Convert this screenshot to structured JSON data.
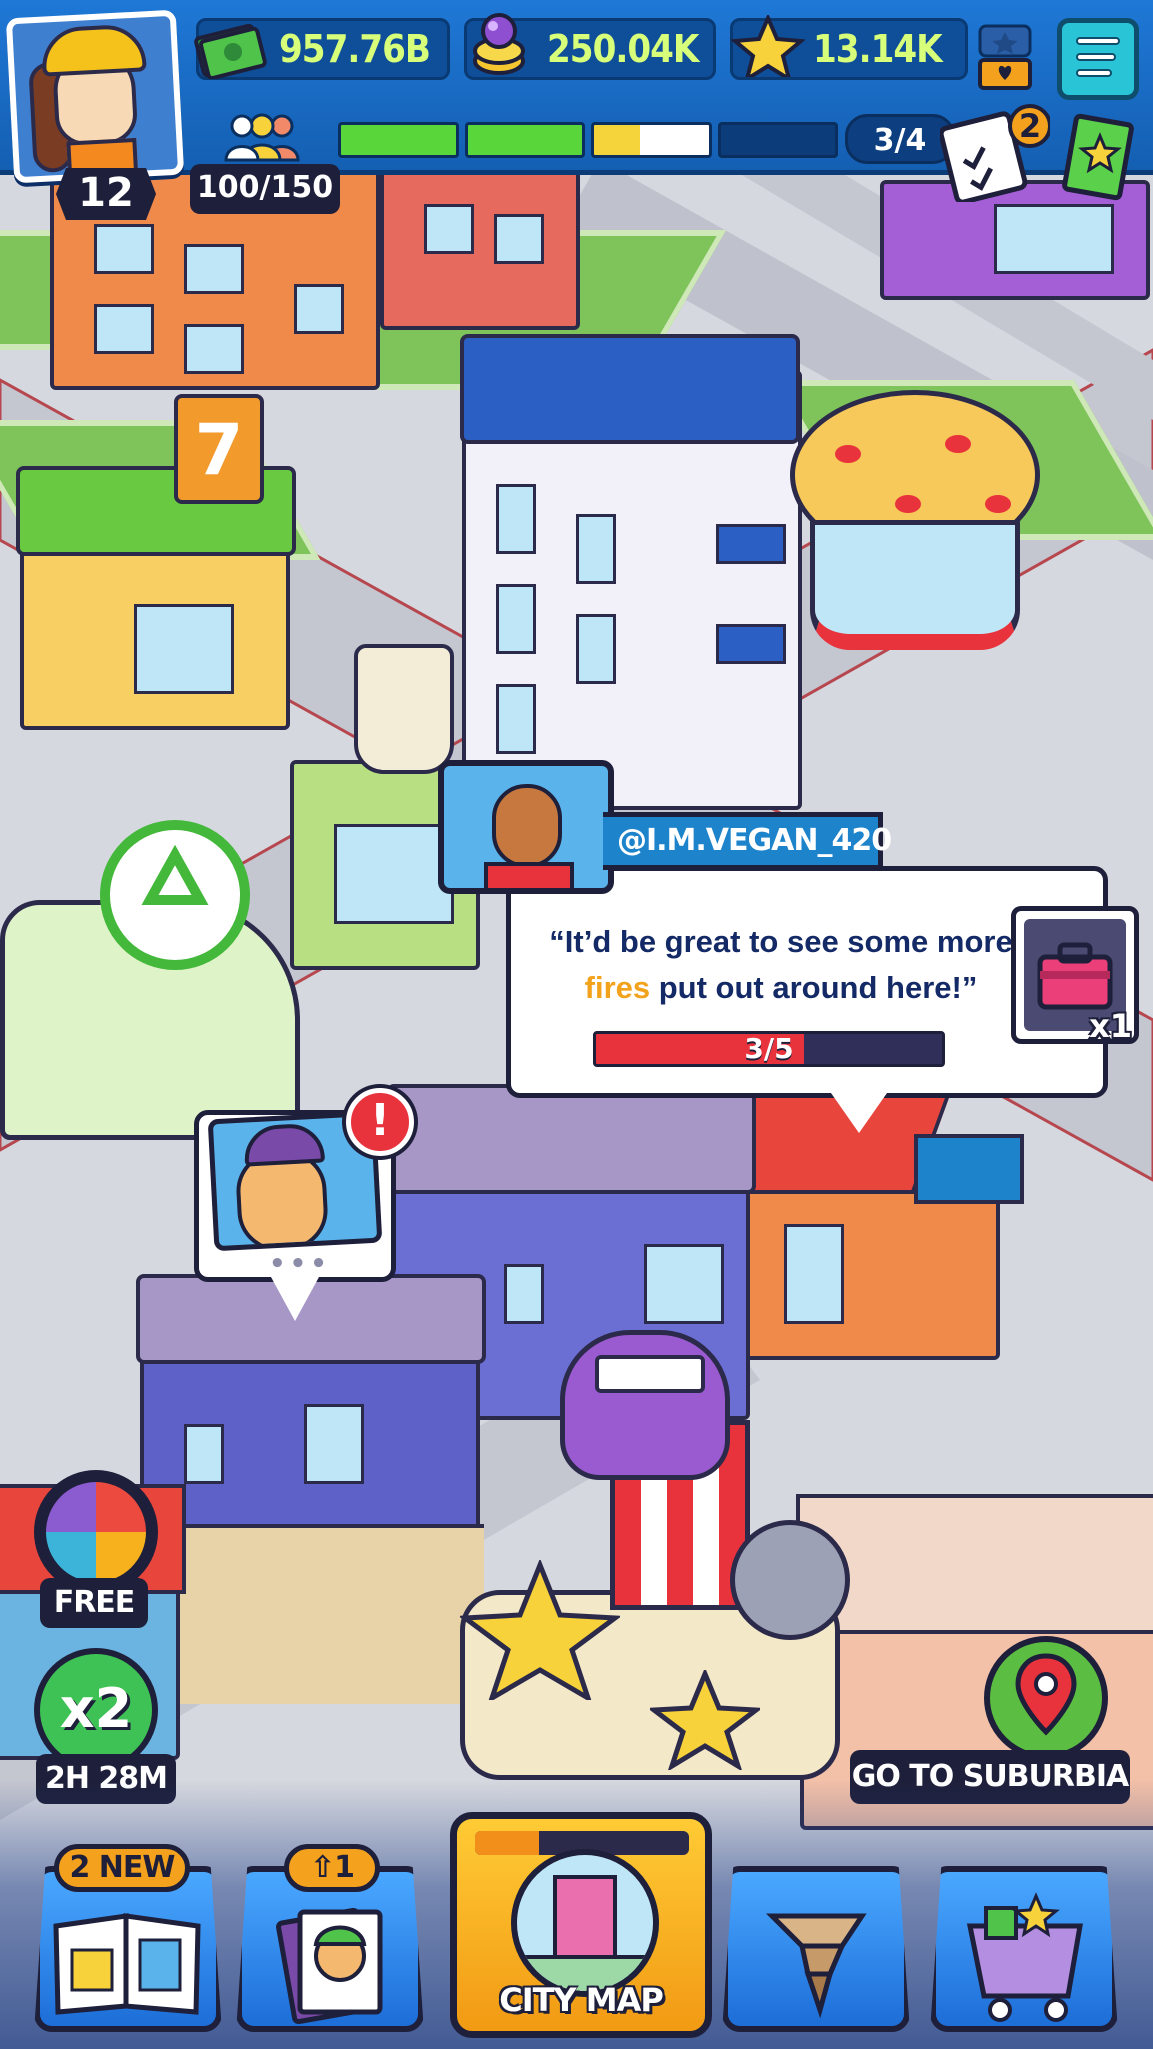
{
  "hud": {
    "player_level": "12",
    "population": "100/150",
    "cash": "957.76B",
    "gems": "250.04K",
    "stars": "13.14K",
    "quest_progress": "3/4",
    "quest_badge": "2",
    "level_progress_segments": [
      1,
      1,
      0.4,
      0
    ],
    "icons": {
      "cash": "cash-stack-icon",
      "gems": "gem-token-icon",
      "stars": "star-icon",
      "population": "population-icon",
      "menu": "menu-icon",
      "chest": "star-chest-icon",
      "quests": "clipboard-icon",
      "ticket": "ticket-icon"
    }
  },
  "quest": {
    "npc_handle": "@I.M.VEGAN_420",
    "text_before": "“It’d be great to see some more",
    "text_highlight": "fires",
    "text_after": "put out around here!”",
    "progress_label": "3/5",
    "progress_value": 0.6,
    "reward_qty": "x1",
    "reward_icon": "toolbox-icon"
  },
  "npc_bubble": {
    "alert": "!",
    "dots": "•••"
  },
  "left_buttons": {
    "wheel_label": "FREE",
    "boost_label": "x2",
    "boost_timer": "2H 28M"
  },
  "right_buttons": {
    "suburbia_label": "GO TO SUBURBIA"
  },
  "bottom_nav": {
    "collection_tag": "2 NEW",
    "characters_tag": "⇧1",
    "city_map_label": "CITY MAP",
    "city_map_progress": 0.3
  },
  "colors": {
    "hud_blue": "#1f78d6",
    "resource_text": "#c9f56a",
    "quest_text": "#142a66",
    "quest_highlight": "#f2a21b",
    "progress_red": "#e8333c",
    "nav_blue": "#1d6ed8",
    "city_map_orange": "#f29a13"
  }
}
